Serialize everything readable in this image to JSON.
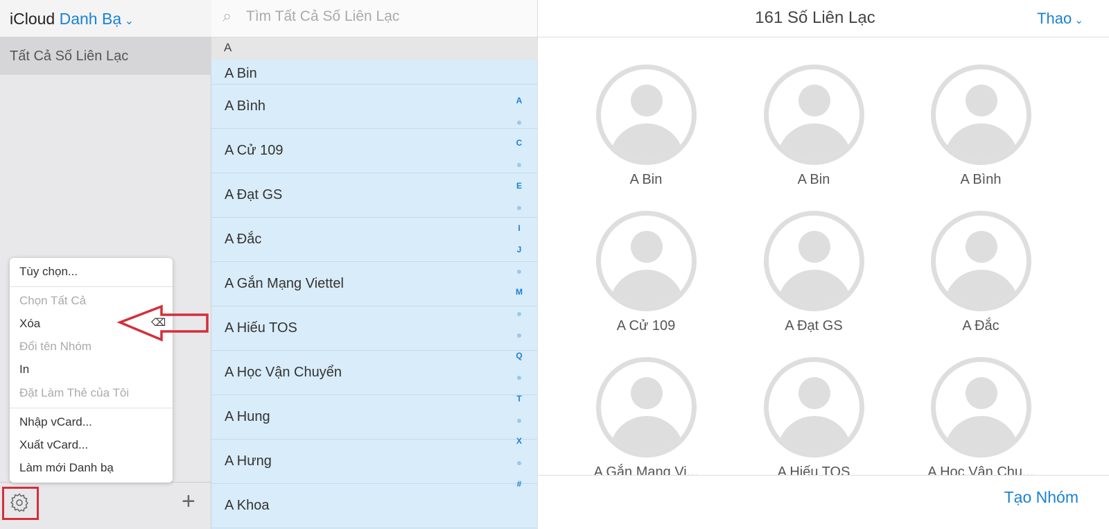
{
  "sidebar": {
    "app": "iCloud",
    "section": "Danh Bạ",
    "group": "Tất Cả Số Liên Lạc"
  },
  "search": {
    "placeholder": "Tìm Tất Cả Số Liên Lạc"
  },
  "list": {
    "section": "A",
    "rows": [
      "A Bin",
      "A Bình",
      "A Cử 109",
      "A Đạt GS",
      "A Đắc",
      "A Gắn Mạng Viettel",
      "A Hiếu TOS",
      "A Học Vận Chuyển",
      "A Hung",
      "A Hưng",
      "A Khoa"
    ],
    "index": [
      "A",
      "•",
      "C",
      "•",
      "E",
      "•",
      "I",
      "J",
      "•",
      "M",
      "•",
      "•",
      "Q",
      "•",
      "T",
      "•",
      "X",
      "•",
      "#"
    ]
  },
  "detail": {
    "count": "161 Số Liên Lạc",
    "actions": "Thao",
    "create_group": "Tạo Nhóm",
    "cards": [
      "A Bin",
      "A Bin",
      "A Bình",
      "A Cử 109",
      "A Đạt GS",
      "A Đắc",
      "A Gắn Mạng Vi...",
      "A Hiếu TOS",
      "A Học Vận Chu..."
    ]
  },
  "menu": {
    "items": [
      {
        "label": "Tùy chọn...",
        "enabled": true
      },
      {
        "label": "Chọn Tất Cả",
        "enabled": false
      },
      {
        "label": "Xóa",
        "enabled": true
      },
      {
        "label": "Đổi tên Nhóm",
        "enabled": false
      },
      {
        "label": "In",
        "enabled": true
      },
      {
        "label": "Đặt Làm Thẻ của Tôi",
        "enabled": false
      },
      {
        "label": "Nhập vCard...",
        "enabled": true
      },
      {
        "label": "Xuất vCard...",
        "enabled": true
      },
      {
        "label": "Làm mới Danh bạ",
        "enabled": true
      }
    ]
  },
  "colors": {
    "accent": "#1a82d4",
    "highlight": "#d32f3a",
    "list_bg": "#d9ecf9"
  }
}
